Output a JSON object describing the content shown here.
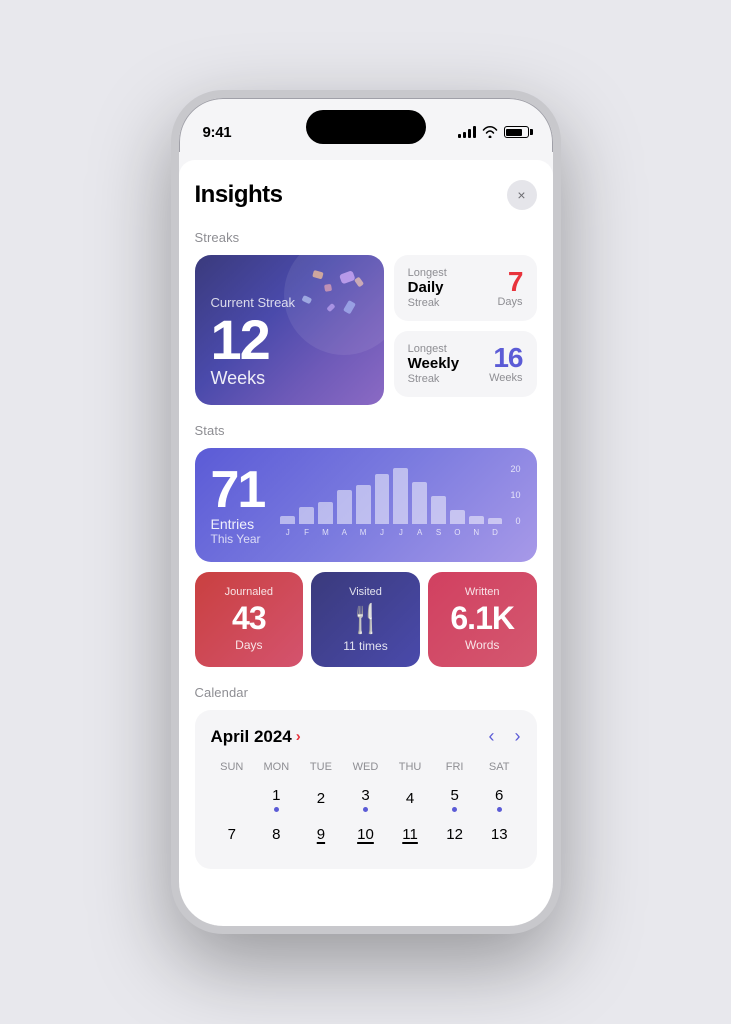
{
  "status_bar": {
    "time": "9:41",
    "signal_label": "Signal",
    "wifi_label": "WiFi",
    "battery_label": "Battery"
  },
  "modal": {
    "title": "Insights",
    "close_label": "×"
  },
  "streaks": {
    "section_label": "Streaks",
    "current_streak": {
      "label": "Current Streak",
      "value": "12",
      "unit": "Weeks"
    },
    "longest_daily": {
      "top_label": "Longest",
      "type_label": "Daily",
      "bottom_label": "Streak",
      "value": "7",
      "unit": "Days"
    },
    "longest_weekly": {
      "top_label": "Longest",
      "type_label": "Weekly",
      "bottom_label": "Streak",
      "value": "16",
      "unit": "Weeks"
    }
  },
  "stats": {
    "section_label": "Stats",
    "entries": {
      "value": "71",
      "label": "Entries",
      "sublabel": "This Year"
    },
    "chart": {
      "max_label": "20",
      "mid_label": "10",
      "min_label": "0",
      "months": [
        "J",
        "F",
        "M",
        "A",
        "M",
        "J",
        "J",
        "A",
        "S",
        "O",
        "N",
        "D"
      ],
      "bars": [
        3,
        6,
        8,
        12,
        14,
        18,
        20,
        15,
        10,
        5,
        3,
        2
      ]
    },
    "journaled": {
      "label": "Journaled",
      "value": "43",
      "unit": "Days"
    },
    "visited": {
      "label": "Visited",
      "icon": "🍴",
      "unit": "11 times"
    },
    "written": {
      "label": "Written",
      "value": "6.1K",
      "unit": "Words"
    }
  },
  "calendar": {
    "section_label": "Calendar",
    "month_label": "April 2024",
    "chevron": "›",
    "nav_prev": "‹",
    "nav_next": "›",
    "weekdays": [
      "SUN",
      "MON",
      "TUE",
      "WED",
      "THU",
      "FRI",
      "SAT"
    ],
    "week1": [
      {
        "day": "",
        "dot": false,
        "empty": true
      },
      {
        "day": "1",
        "dot": true,
        "empty": false
      },
      {
        "day": "2",
        "dot": false,
        "empty": false
      },
      {
        "day": "3",
        "dot": true,
        "empty": false
      },
      {
        "day": "4",
        "dot": false,
        "empty": false
      },
      {
        "day": "5",
        "dot": true,
        "empty": false
      },
      {
        "day": "6",
        "dot": true,
        "empty": false
      }
    ],
    "week2": [
      {
        "day": "7",
        "dot": false,
        "empty": false
      },
      {
        "day": "8",
        "dot": false,
        "empty": false
      },
      {
        "day": "9",
        "dot": false,
        "underline": true,
        "empty": false
      },
      {
        "day": "10",
        "dot": false,
        "underline": true,
        "empty": false
      },
      {
        "day": "11",
        "dot": false,
        "underline": true,
        "empty": false
      },
      {
        "day": "12",
        "dot": false,
        "empty": false
      },
      {
        "day": "13",
        "dot": false,
        "empty": false
      }
    ]
  },
  "colors": {
    "accent_red": "#e8333c",
    "accent_blue": "#5b5bd6",
    "card_navy": "#3a3a7c",
    "card_coral": "#d14060"
  }
}
